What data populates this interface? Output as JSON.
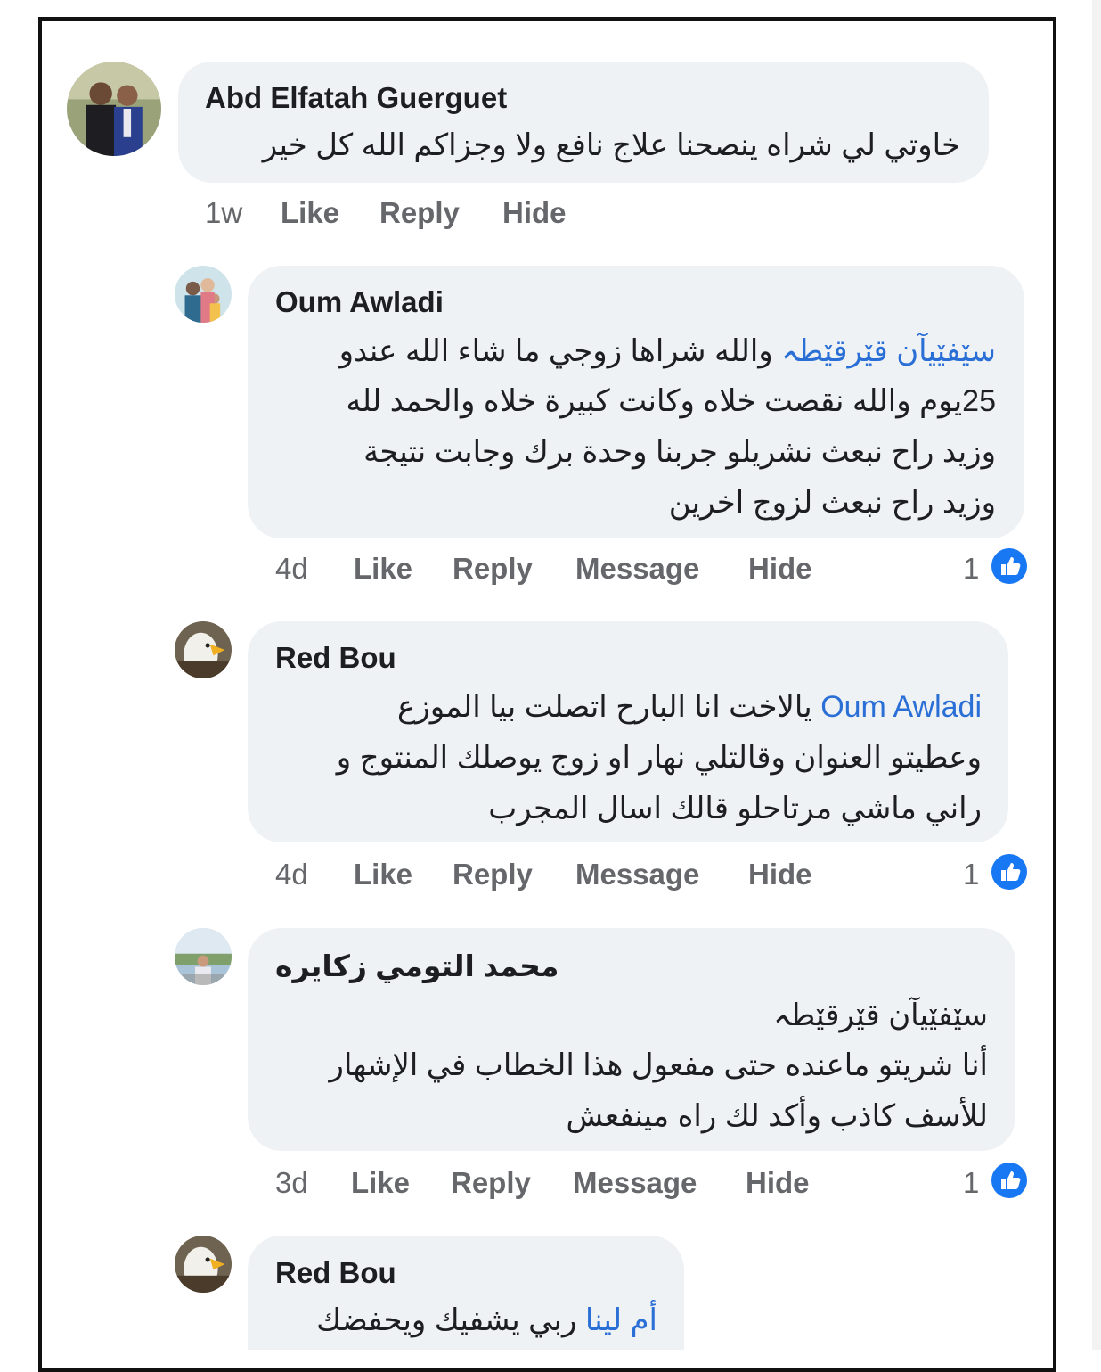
{
  "comments": [
    {
      "author": "Abd Elfatah Guerguet",
      "lines": [
        "خاوتي لي شراه ينصحنا علاج نافع ولا وجزاكم الله كل خير"
      ],
      "time": "1w",
      "actions": [
        "Like",
        "Reply",
        "Hide"
      ]
    },
    {
      "author": "Oum Awladi",
      "mention": "سێفێیآن قێرقێطہ",
      "line1_rest": " والله شراها زوجي ما شاء الله عندو",
      "lines": [
        "25يوم والله نقصت خلاه وكانت كبيرة خلاه والحمد لله",
        "وزيد راح نبعث نشريلو جربنا وحدة برك وجابت نتيجة",
        "وزيد راح نبعث لزوج اخرين"
      ],
      "time": "4d",
      "actions": [
        "Like",
        "Reply",
        "Message",
        "Hide"
      ],
      "reaction_count": "1"
    },
    {
      "author": "Red Bou",
      "mention": "Oum Awladi",
      "line1_rest": " يالاخت انا البارح اتصلت بيا الموزع",
      "lines": [
        "وعطيتو العنوان وقالتلي نهار او زوج يوصلك المنتوج و",
        "راني ماشي مرتاحلو قالك  اسال المجرب"
      ],
      "time": "4d",
      "actions": [
        "Like",
        "Reply",
        "Message",
        "Hide"
      ],
      "reaction_count": "1"
    },
    {
      "author": "محمد التومي زكايره",
      "lines": [
        "سێفێیآن قێرقێطہ",
        "أنا شريتو ماعنده حتى مفعول هذا الخطاب في الإشهار",
        "للأسف كاذب وأكد لك راه مينفعش"
      ],
      "time": "3d",
      "actions": [
        "Like",
        "Reply",
        "Message",
        "Hide"
      ],
      "reaction_count": "1"
    },
    {
      "author": "Red Bou",
      "mention": "أم لينا",
      "line1_rest": " ربي يشفيك ويحفضك"
    }
  ],
  "colors": {
    "bubble": "#eff2f5",
    "mention": "#2a6fd6",
    "meta_gray": "#65676b",
    "like_blue": "#1877f2"
  },
  "icons": [
    "like-thumb-icon"
  ]
}
